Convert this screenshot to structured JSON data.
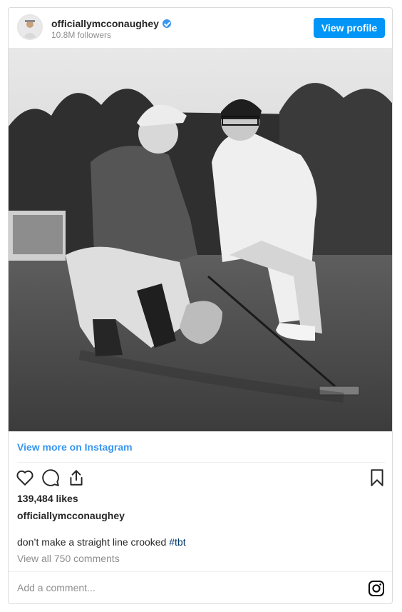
{
  "header": {
    "username": "officiallymcconaughey",
    "followers": "10.8M followers",
    "view_profile_label": "View profile"
  },
  "post": {
    "view_more_label": "View more on Instagram",
    "likes": "139,484 likes",
    "author": "officiallymcconaughey",
    "caption_text": "don’t make a straight line crooked ",
    "hashtag": "#tbt",
    "view_comments": "View all 750 comments",
    "add_comment_placeholder": "Add a comment..."
  },
  "colors": {
    "accent": "#0095f6",
    "link": "#3897f0",
    "hashtag": "#00376b",
    "muted": "#8e8e8e"
  },
  "icons": [
    "heart-icon",
    "comment-icon",
    "share-icon",
    "bookmark-icon",
    "instagram-logo-icon",
    "verified-badge-icon"
  ]
}
